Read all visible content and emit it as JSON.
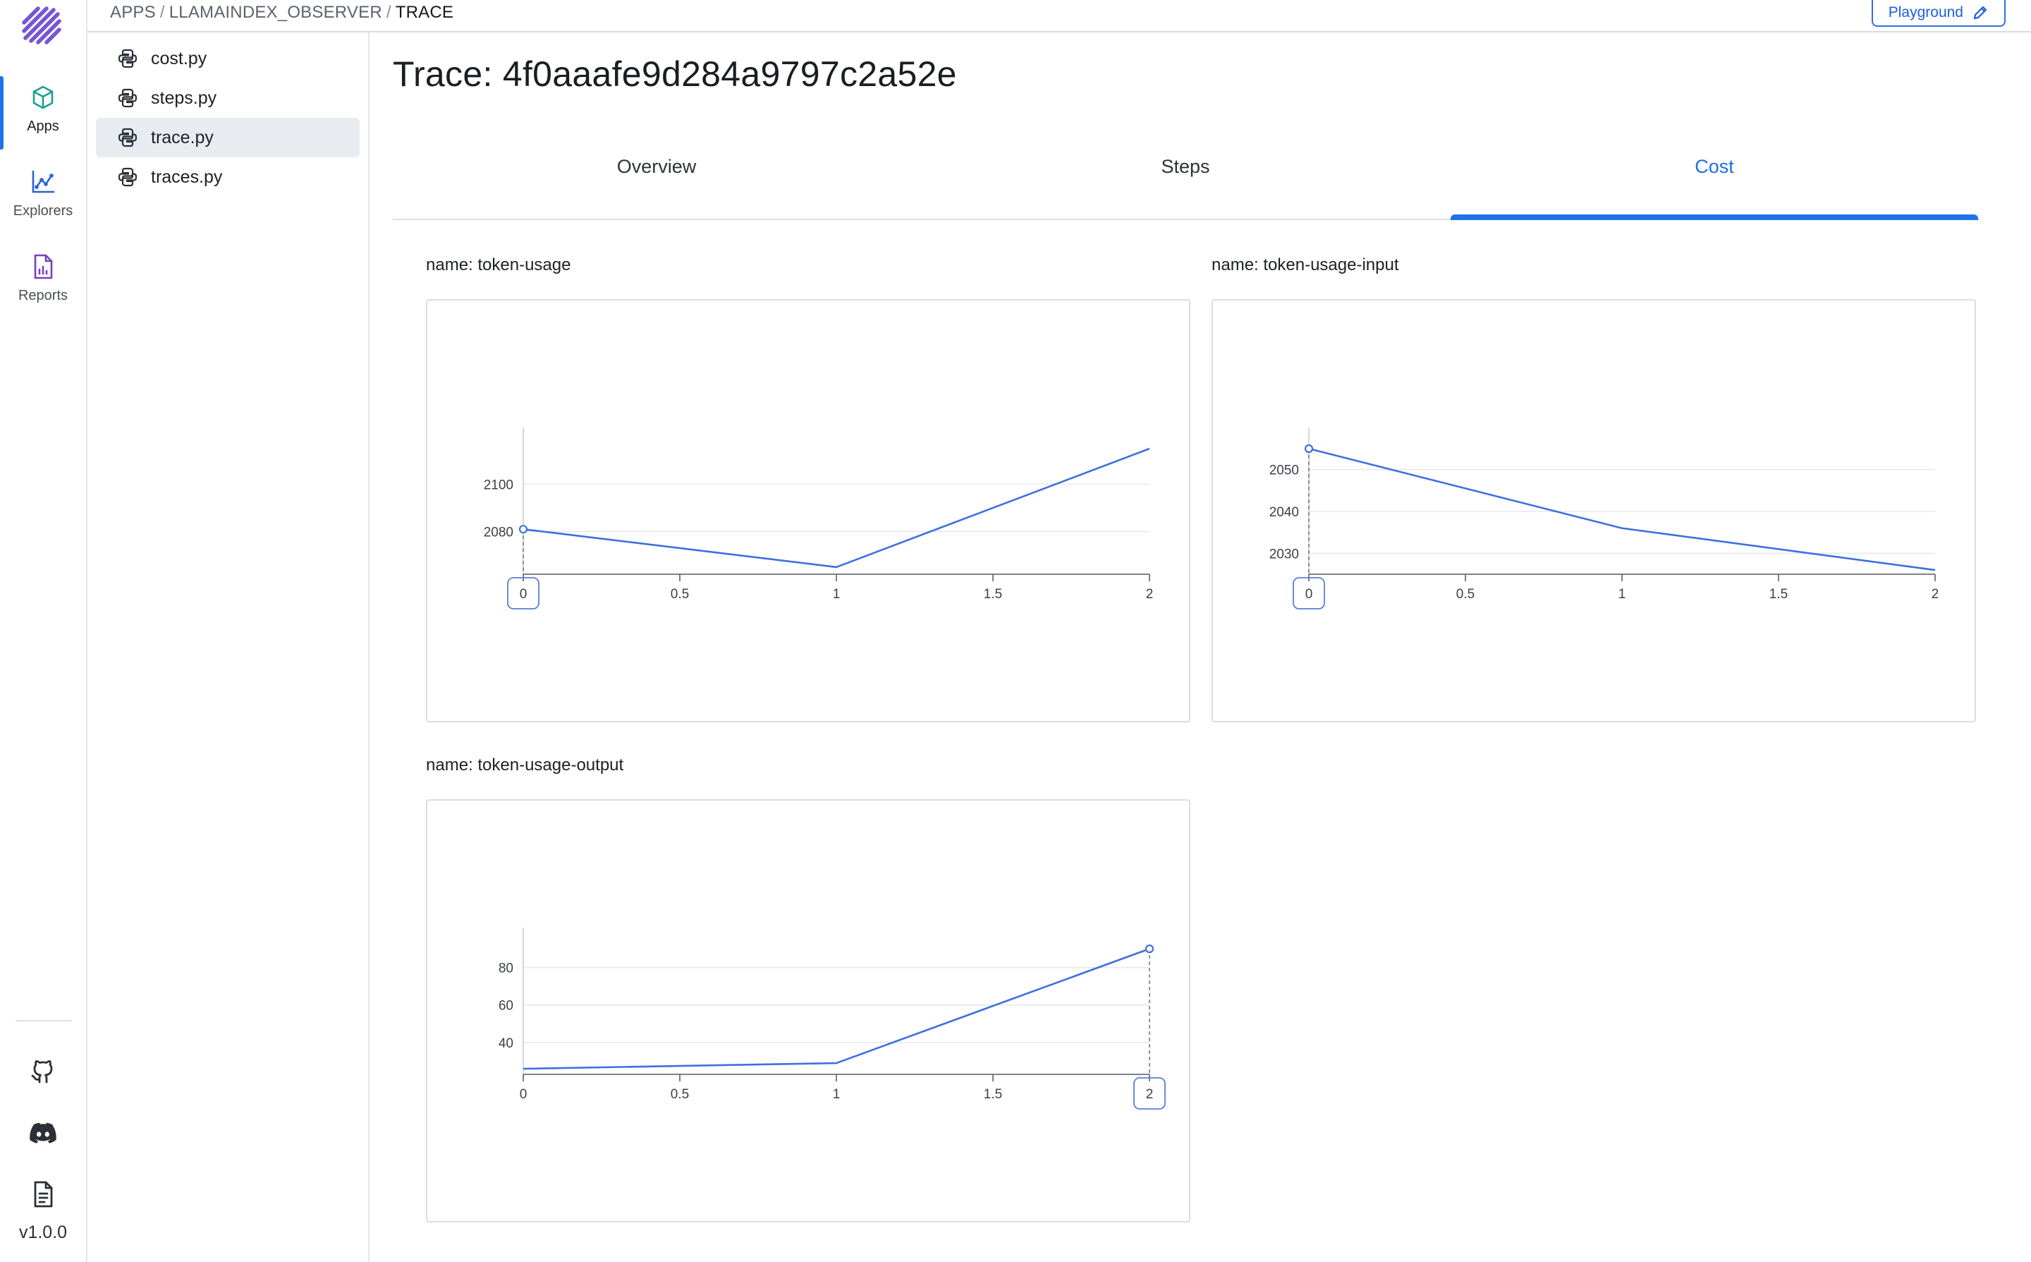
{
  "nav": {
    "items": [
      {
        "label": "Apps",
        "icon": "cube-icon",
        "active": true
      },
      {
        "label": "Explorers",
        "icon": "graph-icon",
        "active": false
      },
      {
        "label": "Reports",
        "icon": "report-icon",
        "active": false
      }
    ],
    "bottom_icons": [
      "github-icon",
      "discord-icon",
      "document-icon"
    ],
    "version": "v1.0.0"
  },
  "breadcrumb": {
    "parts": [
      "APPS",
      "LLAMAINDEX_OBSERVER",
      "TRACE"
    ],
    "separator": "/"
  },
  "playground_button": {
    "label": "Playground",
    "icon": "pencil-icon"
  },
  "files": [
    {
      "name": "cost.py",
      "active": false
    },
    {
      "name": "steps.py",
      "active": false
    },
    {
      "name": "trace.py",
      "active": true
    },
    {
      "name": "traces.py",
      "active": false
    }
  ],
  "page_title": "Trace: 4f0aaafe9d284a9797c2a52e",
  "tabs": [
    {
      "label": "Overview",
      "active": false
    },
    {
      "label": "Steps",
      "active": false
    },
    {
      "label": "Cost",
      "active": true
    }
  ],
  "colors": {
    "accent": "#1e73e8",
    "line": "#3f6fe0"
  },
  "chart_data": [
    {
      "type": "line",
      "label": "name: token-usage",
      "x": [
        0,
        1,
        2
      ],
      "values": [
        2081,
        2065,
        2115
      ],
      "xticks": [
        "0",
        "0.5",
        "1",
        "1.5",
        "2"
      ],
      "yticks": [
        "2080",
        "2100"
      ],
      "xlim": [
        0,
        2
      ],
      "ylim": [
        2062,
        2115
      ],
      "grid": true,
      "highlight_x": "0"
    },
    {
      "type": "line",
      "label": "name: token-usage-input",
      "x": [
        0,
        1,
        2
      ],
      "values": [
        2055,
        2036,
        2026
      ],
      "xticks": [
        "0",
        "0.5",
        "1",
        "1.5",
        "2"
      ],
      "yticks": [
        "2030",
        "2040",
        "2050"
      ],
      "xlim": [
        0,
        2
      ],
      "ylim": [
        2025,
        2055
      ],
      "grid": true,
      "highlight_x": "0"
    },
    {
      "type": "line",
      "label": "name: token-usage-output",
      "x": [
        0,
        1,
        2
      ],
      "values": [
        26,
        29,
        90
      ],
      "xticks": [
        "0",
        "0.5",
        "1",
        "1.5",
        "2"
      ],
      "yticks": [
        "40",
        "60",
        "80"
      ],
      "xlim": [
        0,
        2
      ],
      "ylim": [
        23,
        90
      ],
      "grid": true,
      "highlight_x": "2"
    }
  ]
}
